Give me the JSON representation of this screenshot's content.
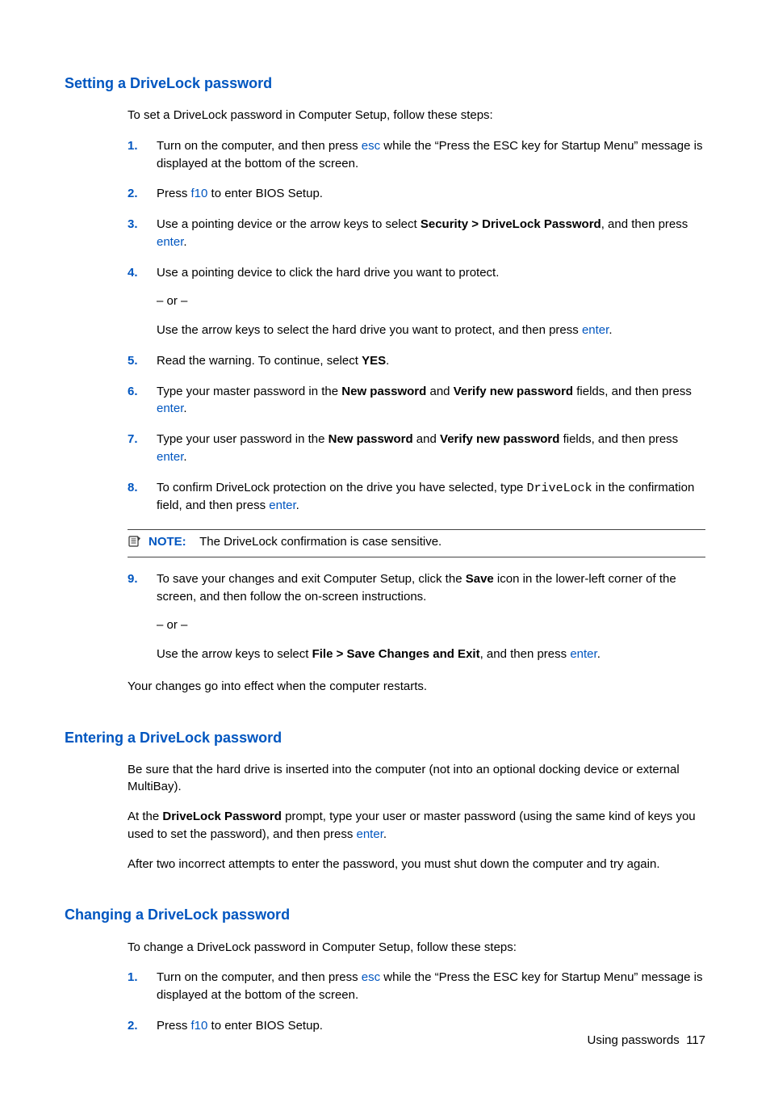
{
  "sections": [
    {
      "heading": "Setting a DriveLock password",
      "intro": "To set a DriveLock password in Computer Setup, follow these steps:",
      "closing": "Your changes go into effect when the computer restarts."
    },
    {
      "heading": "Entering a DriveLock password"
    },
    {
      "heading": "Changing a DriveLock password",
      "intro": "To change a DriveLock password in Computer Setup, follow these steps:"
    }
  ],
  "ol1": {
    "n1": "1.",
    "n2": "2.",
    "n3": "3.",
    "n4": "4.",
    "n5": "5.",
    "n6": "6.",
    "n7": "7.",
    "n8": "8.",
    "n9": "9."
  },
  "s1": {
    "step1_a": "Turn on the computer, and then press ",
    "step1_key": "esc",
    "step1_b": " while the “Press the ESC key for Startup Menu” message is displayed at the bottom of the screen.",
    "step2_a": "Press ",
    "step2_key": "f10",
    "step2_b": " to enter BIOS Setup.",
    "step3_a": "Use a pointing device or the arrow keys to select ",
    "step3_bold": "Security > DriveLock Password",
    "step3_b": ", and then press ",
    "step3_key": "enter",
    "step3_c": ".",
    "step4_a": "Use a pointing device to click the hard drive you want to protect.",
    "step4_or": "– or –",
    "step4_b": "Use the arrow keys to select the hard drive you want to protect, and then press ",
    "step4_key": "enter",
    "step4_c": ".",
    "step5_a": "Read the warning. To continue, select ",
    "step5_bold": "YES",
    "step5_b": ".",
    "step6_a": "Type your master password in the ",
    "step6_bold1": "New password",
    "step6_b": " and ",
    "step6_bold2": "Verify new password",
    "step6_c": " fields, and then press ",
    "step6_key": "enter",
    "step6_d": ".",
    "step7_a": "Type your user password in the ",
    "step7_bold1": "New password",
    "step7_b": " and ",
    "step7_bold2": "Verify new password",
    "step7_c": " fields, and then press ",
    "step7_key": "enter",
    "step7_d": ".",
    "step8_a": "To confirm DriveLock protection on the drive you have selected, type ",
    "step8_mono": "DriveLock",
    "step8_b": " in the confirmation field, and then press ",
    "step8_key": "enter",
    "step8_c": ".",
    "note_label": "NOTE:",
    "note_text": "The DriveLock confirmation is case sensitive.",
    "step9_a": "To save your changes and exit Computer Setup, click the ",
    "step9_bold1": "Save",
    "step9_b": " icon in the lower-left corner of the screen, and then follow the on-screen instructions.",
    "step9_or": "– or –",
    "step9_c": "Use the arrow keys to select ",
    "step9_bold2": "File > Save Changes and Exit",
    "step9_d": ", and then press ",
    "step9_key": "enter",
    "step9_e": "."
  },
  "s2": {
    "p1": "Be sure that the hard drive is inserted into the computer (not into an optional docking device or external MultiBay).",
    "p2_a": "At the ",
    "p2_bold": "DriveLock Password",
    "p2_b": " prompt, type your user or master password (using the same kind of keys you used to set the password), and then press ",
    "p2_key": "enter",
    "p2_c": ".",
    "p3": "After two incorrect attempts to enter the password, you must shut down the computer and try again."
  },
  "ol3": {
    "n1": "1.",
    "n2": "2."
  },
  "s3": {
    "step1_a": "Turn on the computer, and then press ",
    "step1_key": "esc",
    "step1_b": " while the “Press the ESC key for Startup Menu” message is displayed at the bottom of the screen.",
    "step2_a": "Press ",
    "step2_key": "f10",
    "step2_b": " to enter BIOS Setup."
  },
  "footer": {
    "section": "Using passwords",
    "page": "117"
  }
}
